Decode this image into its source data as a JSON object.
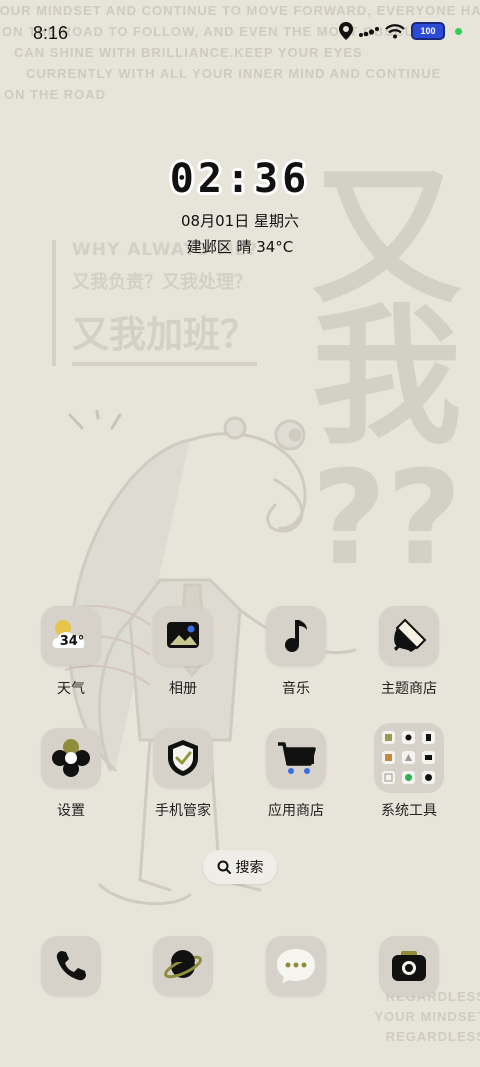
{
  "status_bar": {
    "time": "8:16",
    "battery_level": "100",
    "icons": [
      "location-icon",
      "signal-icon",
      "wifi-icon",
      "battery-icon",
      "active-dot-icon"
    ]
  },
  "lock_clock": {
    "time": "02:36",
    "date": "08月01日 星期六",
    "weather": "建邺区 晴 34°C"
  },
  "apps": [
    {
      "label": "天气",
      "icon": "weather-icon",
      "badge": "34°"
    },
    {
      "label": "相册",
      "icon": "gallery-icon"
    },
    {
      "label": "音乐",
      "icon": "music-icon"
    },
    {
      "label": "主题商店",
      "icon": "theme-brush-icon"
    },
    {
      "label": "设置",
      "icon": "settings-flower-icon"
    },
    {
      "label": "手机管家",
      "icon": "shield-check-icon"
    },
    {
      "label": "应用商店",
      "icon": "cart-icon"
    },
    {
      "label": "系统工具",
      "icon": "folder-icon"
    }
  ],
  "search": {
    "label": "搜索",
    "icon": "search-icon"
  },
  "dock": [
    {
      "icon": "phone-icon"
    },
    {
      "icon": "browser-planet-icon"
    },
    {
      "icon": "messages-icon"
    },
    {
      "icon": "camera-icon"
    }
  ],
  "wallpaper": {
    "top_lines": [
      "YOUR MINDSET AND CONTINUE TO MOVE FORWARD, EVERYONE HAS",
      "ON THE ROAD TO FOLLOW, AND EVEN THE MOST OBSCURE",
      "CAN SHINE WITH BRILLIANCE.KEEP YOUR EYES",
      "CURRENTLY WITH ALL YOUR INNER MIND AND CONTINUE",
      "ON THE ROAD"
    ],
    "big_text": [
      "又",
      "我",
      "??"
    ],
    "quote_en": "WHY ALWAYS ME?",
    "quote_cn1": "又我负责？又我处理？",
    "quote_cn2": "又我加班？",
    "bottom_lines": [
      "REGARDLESS",
      "YOUR MINDSET",
      "REGARDLESS"
    ]
  },
  "colors": {
    "background": "#e7e4da",
    "tile": "#d6d2c9",
    "battery": "#2c4bd8",
    "active_dot": "#2cd155",
    "shield_check": "#8f9a3c"
  }
}
